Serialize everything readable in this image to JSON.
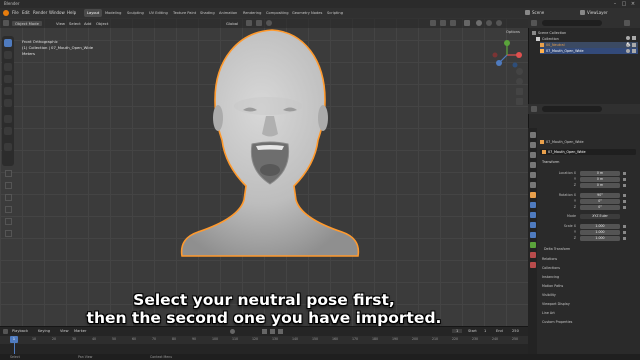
{
  "app": {
    "title": "Blender"
  },
  "menus": [
    "File",
    "Edit",
    "Render",
    "Window",
    "Help"
  ],
  "workspaces": [
    "Layout",
    "Modeling",
    "Sculpting",
    "UV Editing",
    "Texture Paint",
    "Shading",
    "Animation",
    "Rendering",
    "Compositing",
    "Geometry Nodes",
    "Scripting"
  ],
  "active_workspace": "Layout",
  "top_right": {
    "scene": "Scene",
    "view_layer": "ViewLayer"
  },
  "viewport_header": {
    "mode": "Object Mode",
    "items": [
      "View",
      "Select",
      "Add",
      "Object"
    ],
    "transform": "Global",
    "options": "Options"
  },
  "viewport_info": {
    "view": "Front Orthographic",
    "collection": "(1) Collection | 07_Mouth_Open_Wide",
    "units": "Meters"
  },
  "outliner": {
    "items": [
      {
        "label": "Scene Collection",
        "indent": 0
      },
      {
        "label": "Collection",
        "indent": 1
      },
      {
        "label": "00_Neutral",
        "indent": 2
      },
      {
        "label": "07_Mouth_Open_Wide",
        "indent": 2
      }
    ]
  },
  "properties": {
    "object_name_path": "07_Mouth_Open_Wide",
    "object_name": "07_Mouth_Open_Wide",
    "transform_label": "Transform",
    "location": {
      "label": "Location X",
      "x": "0 m",
      "y": "0 m",
      "z": "0 m"
    },
    "rotation": {
      "label": "Rotation X",
      "x": "90°",
      "y": "0°",
      "z": "0°"
    },
    "mode_label": "Mode",
    "mode": "XYZ Euler",
    "scale": {
      "label": "Scale X",
      "x": "1.000",
      "y": "1.000",
      "z": "1.000"
    },
    "axis_y": "Y",
    "axis_z": "Z",
    "panels": [
      "Delta Transform",
      "Relations",
      "Collections",
      "Instancing",
      "Motion Paths",
      "Visibility",
      "Viewport Display",
      "Line Art",
      "Custom Properties"
    ]
  },
  "timeline": {
    "menu": [
      "Playback",
      "Keying",
      "View",
      "Marker"
    ],
    "current_frame": "1",
    "start_label": "Start",
    "start": "1",
    "end_label": "End",
    "end": "250",
    "ticks": [
      "0",
      "10",
      "20",
      "30",
      "40",
      "50",
      "60",
      "70",
      "80",
      "90",
      "100",
      "110",
      "120",
      "130",
      "140",
      "150",
      "160",
      "170",
      "180",
      "190",
      "200",
      "210",
      "220",
      "230",
      "240",
      "250"
    ]
  },
  "statusbar": {
    "select": "Select",
    "pan": "Pan View",
    "context": "Context Menu"
  },
  "subtitle": {
    "line1": "Select your neutral pose first,",
    "line2": "then the second one you have imported."
  },
  "colors": {
    "accent": "#4f7bbf",
    "selection_outline": "#ff9a2e",
    "viewport": "#3b3b3b"
  }
}
